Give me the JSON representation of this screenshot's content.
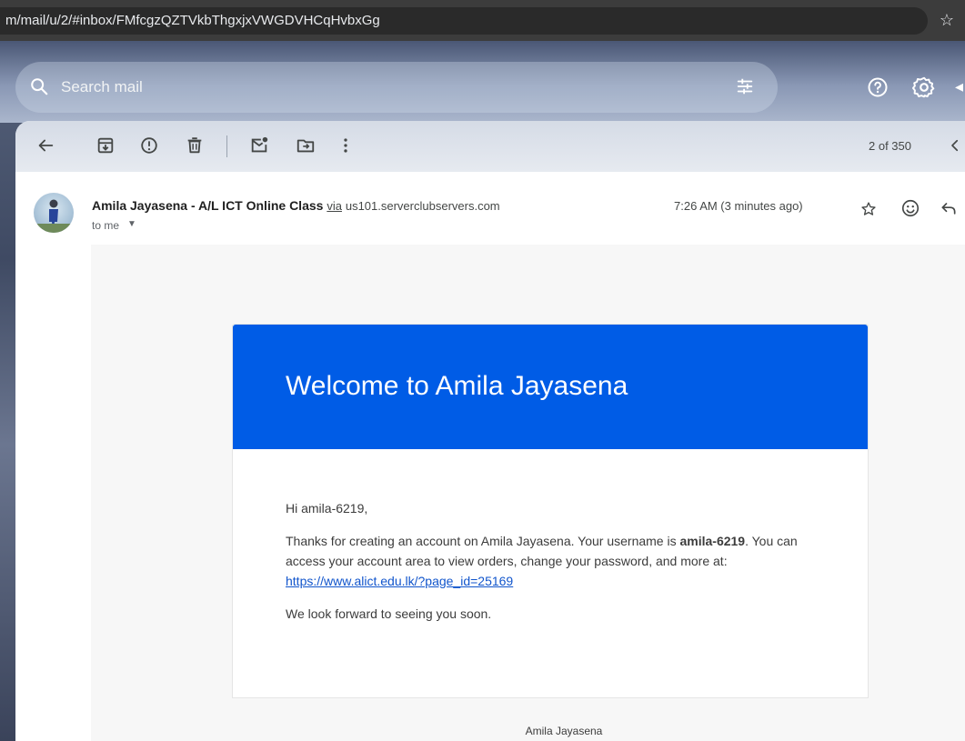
{
  "browser": {
    "url": "m/mail/u/2/#inbox/FMfcgzQZTVkbThgxjxVWGDVHCqHvbxGg"
  },
  "header": {
    "search_placeholder": "Search mail"
  },
  "toolbar": {
    "pagination": "2 of 350"
  },
  "message": {
    "sender_name": "Amila Jayasena - A/L ICT Online Class",
    "via_label": "via",
    "via_domain": "us101.serverclubservers.com",
    "recipient": "to me",
    "timestamp": "7:26 AM (3 minutes ago)"
  },
  "email": {
    "heading": "Welcome to Amila Jayasena",
    "greeting": "Hi amila-6219,",
    "para1_start": "Thanks for creating an account on Amila Jayasena. Your username is ",
    "username": "amila-6219",
    "para1_mid": ". You can access your account area to view orders, change your password, and more at: ",
    "link": "https://www.alict.edu.lk/?page_id=25169",
    "para2": "We look forward to seeing you soon.",
    "footer": "Amila Jayasena"
  },
  "colors": {
    "email_header_bg": "#005ce6",
    "link": "#1155cc"
  }
}
